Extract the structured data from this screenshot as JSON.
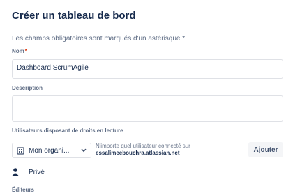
{
  "form": {
    "title": "Créer un tableau de bord",
    "required_hint": "Les champs obligatoires sont marqués d'un astérisque *",
    "name": {
      "label": "Nom",
      "required_mark": "*",
      "value": "Dashboard ScrumAgile"
    },
    "description": {
      "label": "Description",
      "value": ""
    },
    "viewers": {
      "label": "Utilisateurs disposant de droits en lecture",
      "select": {
        "value": "Mon organi...",
        "icon": "organization-icon",
        "caret": "chevron-down-icon"
      },
      "note_line1": "N'importe quel utilisateur connecté sur",
      "note_line2": "essalimeebouchra.atlassian.net",
      "add_button": "Ajouter",
      "private": {
        "label": "Privé",
        "icon": "person-icon"
      }
    },
    "editors": {
      "label": "Éditeurs"
    }
  }
}
